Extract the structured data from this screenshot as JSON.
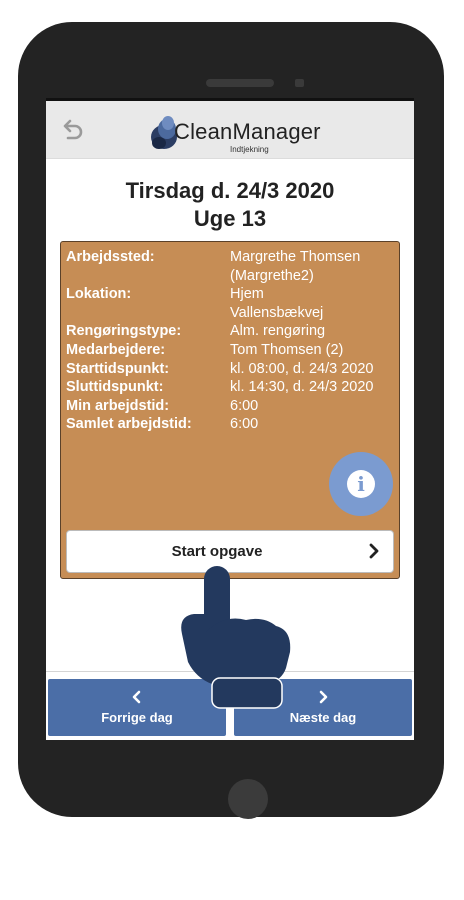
{
  "header": {
    "logo_text": "CleanManager",
    "logo_subtitle": "Indtjekning",
    "back_icon": "undo-arrow-icon"
  },
  "day": {
    "date_title": "Tirsdag d. 24/3 2020",
    "week_title": "Uge 13"
  },
  "task": {
    "rows": [
      {
        "label": "Arbejdssted:",
        "value": "Margrethe Thomsen",
        "value2": "(Margrethe2)"
      },
      {
        "label": "Lokation:",
        "value": "Hjem",
        "value2": "Vallensbækvej"
      },
      {
        "label": "Rengøringstype:",
        "value": "Alm. rengøring"
      },
      {
        "label": "Medarbejdere:",
        "value": "Tom Thomsen (2)"
      },
      {
        "label": "Starttidspunkt:",
        "value": "kl. 08:00, d. 24/3 2020"
      },
      {
        "label": "Sluttidspunkt:",
        "value": "kl. 14:30, d. 24/3 2020"
      },
      {
        "label": "Min arbejdstid:",
        "value": "6:00"
      },
      {
        "label": "Samlet arbejdstid:",
        "value": "6:00"
      }
    ],
    "info_letter": "i",
    "start_label": "Start opgave"
  },
  "nav": {
    "prev_label": "Forrige dag",
    "next_label": "Næste dag"
  },
  "colors": {
    "card": "#c68d55",
    "nav": "#4b6ea7",
    "info": "#7b9bd0",
    "hand": "#23395e",
    "phone": "#232323"
  }
}
